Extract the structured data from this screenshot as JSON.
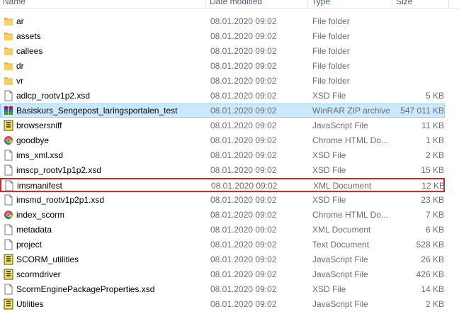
{
  "columns": {
    "name": "Name",
    "date": "Date modified",
    "type": "Type",
    "size": "Size"
  },
  "files": [
    {
      "name": "ar",
      "date": "08.01.2020 09:02",
      "type": "File folder",
      "size": "",
      "icon": "folder-icon"
    },
    {
      "name": "assets",
      "date": "08.01.2020 09:02",
      "type": "File folder",
      "size": "",
      "icon": "folder-icon"
    },
    {
      "name": "callees",
      "date": "08.01.2020 09:02",
      "type": "File folder",
      "size": "",
      "icon": "folder-icon"
    },
    {
      "name": "dr",
      "date": "08.01.2020 09:02",
      "type": "File folder",
      "size": "",
      "icon": "folder-icon"
    },
    {
      "name": "vr",
      "date": "08.01.2020 09:02",
      "type": "File folder",
      "size": "",
      "icon": "folder-icon"
    },
    {
      "name": "adlcp_rootv1p2.xsd",
      "date": "08.01.2020 09:02",
      "type": "XSD File",
      "size": "5 KB",
      "icon": "document-icon"
    },
    {
      "name": "Basiskurs_Sengepost_laringsportalen_test",
      "date": "08.01.2020 09:02",
      "type": "WinRAR ZIP archive",
      "size": "547 011 KB",
      "icon": "winrar-archive-icon"
    },
    {
      "name": "browsersniff",
      "date": "08.01.2020 09:02",
      "type": "JavaScript File",
      "size": "11 KB",
      "icon": "javascript-file-icon"
    },
    {
      "name": "goodbye",
      "date": "08.01.2020 09:02",
      "type": "Chrome HTML Do...",
      "size": "1 KB",
      "icon": "chrome-html-icon"
    },
    {
      "name": "ims_xml.xsd",
      "date": "08.01.2020 09:02",
      "type": "XSD File",
      "size": "2 KB",
      "icon": "document-icon"
    },
    {
      "name": "imscp_rootv1p1p2.xsd",
      "date": "08.01.2020 09:02",
      "type": "XSD File",
      "size": "15 KB",
      "icon": "document-icon"
    },
    {
      "name": "imsmanifest",
      "date": "08.01.2020 09:02",
      "type": "XML Document",
      "size": "12 KB",
      "icon": "document-icon"
    },
    {
      "name": "imsmd_rootv1p2p1.xsd",
      "date": "08.01.2020 09:02",
      "type": "XSD File",
      "size": "23 KB",
      "icon": "document-icon"
    },
    {
      "name": "index_scorm",
      "date": "08.01.2020 09:02",
      "type": "Chrome HTML Do...",
      "size": "7 KB",
      "icon": "chrome-html-icon"
    },
    {
      "name": "metadata",
      "date": "08.01.2020 09:02",
      "type": "XML Document",
      "size": "6 KB",
      "icon": "document-icon"
    },
    {
      "name": "project",
      "date": "08.01.2020 09:02",
      "type": "Text Document",
      "size": "528 KB",
      "icon": "document-icon"
    },
    {
      "name": "SCORM_utilities",
      "date": "08.01.2020 09:02",
      "type": "JavaScript File",
      "size": "26 KB",
      "icon": "javascript-file-icon"
    },
    {
      "name": "scormdriver",
      "date": "08.01.2020 09:02",
      "type": "JavaScript File",
      "size": "426 KB",
      "icon": "javascript-file-icon"
    },
    {
      "name": "ScormEnginePackageProperties.xsd",
      "date": "08.01.2020 09:02",
      "type": "XSD File",
      "size": "14 KB",
      "icon": "document-icon"
    },
    {
      "name": "Utilities",
      "date": "08.01.2020 09:02",
      "type": "JavaScript File",
      "size": "2 KB",
      "icon": "javascript-file-icon"
    }
  ],
  "selected_index": 6,
  "outlined_index": 11,
  "colors": {
    "selection": "#cce8ff",
    "selection_border": "#99d1ff",
    "highlight_outline": "#d62828",
    "folder": "#f3c55a"
  }
}
